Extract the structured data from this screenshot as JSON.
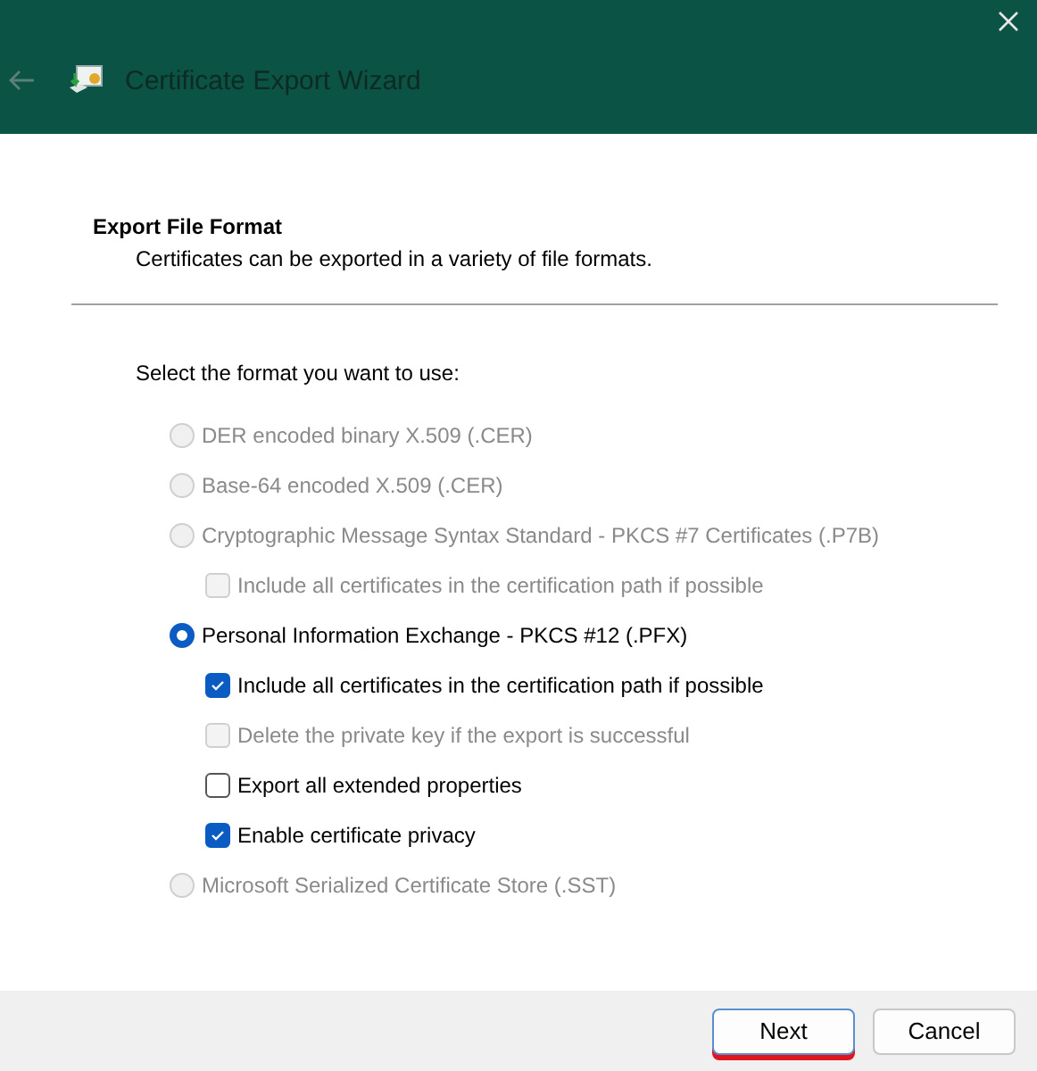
{
  "window": {
    "title": "Certificate Export Wizard"
  },
  "section": {
    "title": "Export File Format",
    "description": "Certificates can be exported in a variety of file formats."
  },
  "prompt": "Select the format you want to use:",
  "options": [
    {
      "kind": "radio",
      "label": "DER encoded binary X.509 (.CER)",
      "selected": false,
      "disabled": true
    },
    {
      "kind": "radio",
      "label": "Base-64 encoded X.509 (.CER)",
      "selected": false,
      "disabled": true
    },
    {
      "kind": "radio",
      "label": "Cryptographic Message Syntax Standard - PKCS #7 Certificates (.P7B)",
      "selected": false,
      "disabled": true
    },
    {
      "kind": "checkbox",
      "label": "Include all certificates in the certification path if possible",
      "checked": false,
      "disabled": true
    },
    {
      "kind": "radio",
      "label": "Personal Information Exchange - PKCS #12 (.PFX)",
      "selected": true,
      "disabled": false
    },
    {
      "kind": "checkbox",
      "label": "Include all certificates in the certification path if possible",
      "checked": true,
      "disabled": false
    },
    {
      "kind": "checkbox",
      "label": "Delete the private key if the export is successful",
      "checked": false,
      "disabled": true
    },
    {
      "kind": "checkbox",
      "label": "Export all extended properties",
      "checked": false,
      "disabled": false
    },
    {
      "kind": "checkbox",
      "label": "Enable certificate privacy",
      "checked": true,
      "disabled": false
    },
    {
      "kind": "radio",
      "label": "Microsoft Serialized Certificate Store (.SST)",
      "selected": false,
      "disabled": true
    }
  ],
  "buttons": [
    {
      "label": "Next",
      "underlined": true
    },
    {
      "label": "Cancel",
      "underlined": false
    }
  ]
}
